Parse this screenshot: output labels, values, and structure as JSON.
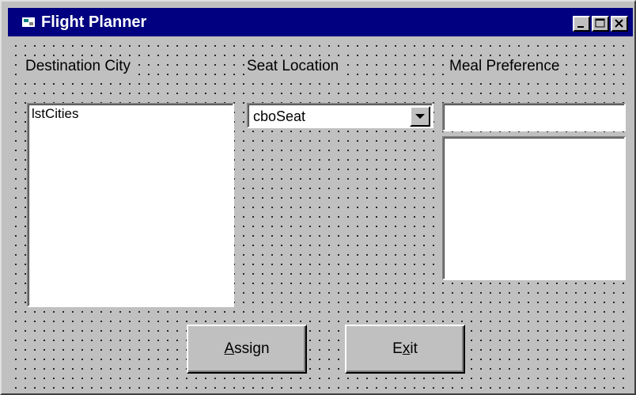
{
  "window": {
    "title": "Flight Planner",
    "controls": {
      "minimize": "minimize",
      "maximize": "maximize",
      "close": "close"
    }
  },
  "labels": {
    "destination": "Destination City",
    "seat": "Seat Location",
    "meal": "Meal Preference"
  },
  "destination_list": {
    "items": [
      "lstCities"
    ]
  },
  "seat_combo": {
    "value": "cboSeat"
  },
  "meal": {
    "text_value": ""
  },
  "buttons": {
    "assign": {
      "access_key": "A",
      "rest": "ssign"
    },
    "exit": {
      "pre": "E",
      "access_key": "x",
      "rest": "it"
    }
  },
  "colors": {
    "titlebar": "#000080",
    "face": "#c0c0c0"
  },
  "icons": [
    "app-icon",
    "minimize-icon",
    "maximize-icon",
    "close-icon",
    "dropdown-arrow-icon"
  ]
}
